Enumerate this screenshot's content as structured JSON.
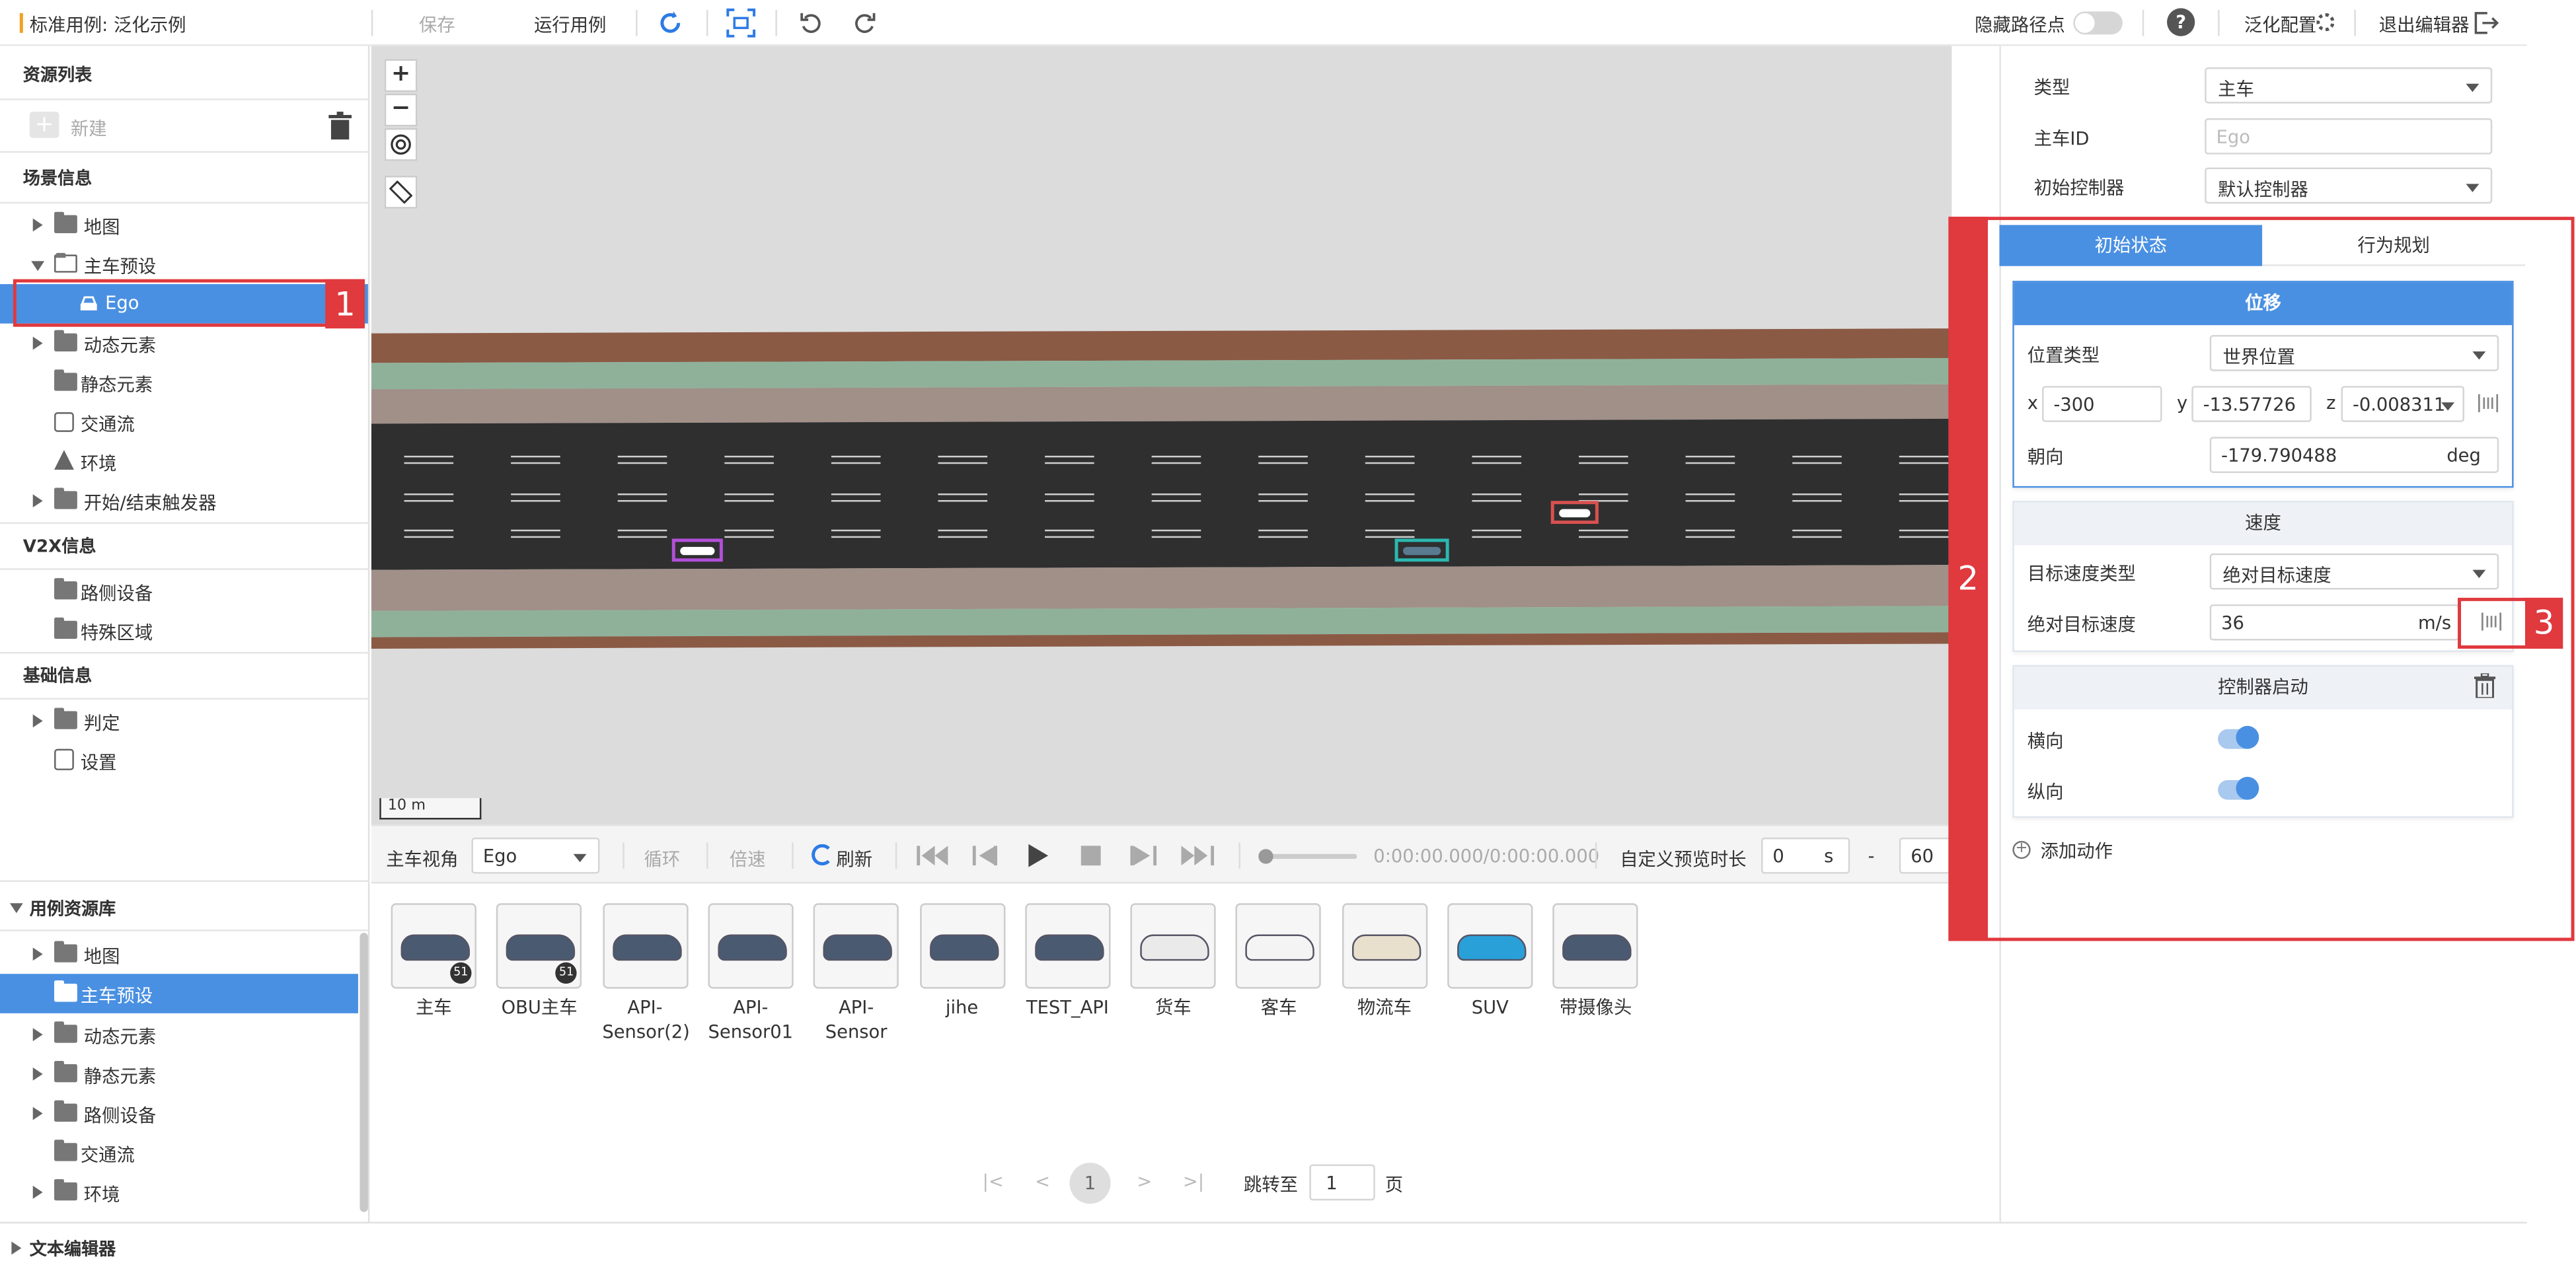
{
  "topbar": {
    "case_title": "标准用例: 泛化示例",
    "save_label": "保存",
    "run_label": "运行用例",
    "hide_waypoints_label": "隐藏路径点",
    "generalize_config_label": "泛化配置",
    "exit_editor_label": "退出编辑器"
  },
  "left": {
    "resource_list_title": "资源列表",
    "new_label": "新建",
    "scene_info_title": "场景信息",
    "scene_tree": [
      {
        "label": "地图"
      },
      {
        "label": "主车预设"
      },
      {
        "label": "Ego"
      },
      {
        "label": "动态元素"
      },
      {
        "label": "静态元素"
      },
      {
        "label": "交通流"
      },
      {
        "label": "环境"
      },
      {
        "label": "开始/结束触发器"
      }
    ],
    "v2x_title": "V2X信息",
    "v2x_tree": [
      {
        "label": "路侧设备"
      },
      {
        "label": "特殊区域"
      }
    ],
    "basic_title": "基础信息",
    "basic_tree": [
      {
        "label": "判定"
      },
      {
        "label": "设置"
      }
    ],
    "library_title": "用例资源库",
    "library_tree": [
      {
        "label": "地图"
      },
      {
        "label": "主车预设"
      },
      {
        "label": "动态元素"
      },
      {
        "label": "静态元素"
      },
      {
        "label": "路侧设备"
      },
      {
        "label": "交通流"
      },
      {
        "label": "环境"
      }
    ],
    "text_editor_label": "文本编辑器"
  },
  "map": {
    "scale_label": "10 m"
  },
  "playbar": {
    "ego_view_label": "主车视角",
    "ego_view_value": "Ego",
    "loop_label": "循环",
    "speed_label": "倍速",
    "refresh_label": "刷新",
    "time_readout": "0:00:00.000/0:00:00.000",
    "preview_label": "自定义预览时长",
    "preview_start": "0",
    "preview_unit": "s",
    "preview_dash": "-",
    "preview_end": "60"
  },
  "assets": [
    {
      "name": "主车",
      "badge": "51"
    },
    {
      "name": "OBU主车",
      "badge": "51"
    },
    {
      "name": "API-Sensor(2)"
    },
    {
      "name": "API-Sensor01"
    },
    {
      "name": "API-Sensor"
    },
    {
      "name": "jihe"
    },
    {
      "name": "TEST_API"
    },
    {
      "name": "货车"
    },
    {
      "name": "客车"
    },
    {
      "name": "物流车"
    },
    {
      "name": "SUV"
    },
    {
      "name": "带摄像头"
    }
  ],
  "pagination": {
    "current_page": "1",
    "jump_label": "跳转至",
    "jump_value": "1",
    "page_suffix": "页"
  },
  "right": {
    "type_label": "类型",
    "type_value": "主车",
    "ego_id_label": "主车ID",
    "ego_id_placeholder": "Ego",
    "controller_label": "初始控制器",
    "controller_value": "默认控制器",
    "tab_initial": "初始状态",
    "tab_behavior": "行为规划",
    "position": {
      "title": "位移",
      "pos_type_label": "位置类型",
      "pos_type_value": "世界位置",
      "x_label": "x",
      "x_value": "-300",
      "y_label": "y",
      "y_value": "-13.57726",
      "z_label": "z",
      "z_value": "-0.008311",
      "heading_label": "朝向",
      "heading_value": "-179.790488",
      "heading_unit": "deg"
    },
    "speed": {
      "title": "速度",
      "target_type_label": "目标速度类型",
      "target_type_value": "绝对目标速度",
      "abs_speed_label": "绝对目标速度",
      "abs_speed_value": "36",
      "abs_speed_unit": "m/s"
    },
    "controller_start": {
      "title": "控制器启动",
      "lateral_label": "横向",
      "longitudinal_label": "纵向",
      "lateral_on": true,
      "longitudinal_on": true
    },
    "add_action_label": "添加动作"
  },
  "annotations": {
    "label1": "1",
    "label2": "2",
    "label3": "3"
  },
  "colors": {
    "accent": "#4a90e2",
    "annotation_red": "#e0393e",
    "road": "#2f2f30",
    "grass": "#8fb19a",
    "sidewalk": "#a09088",
    "curb": "#8b5a45"
  }
}
